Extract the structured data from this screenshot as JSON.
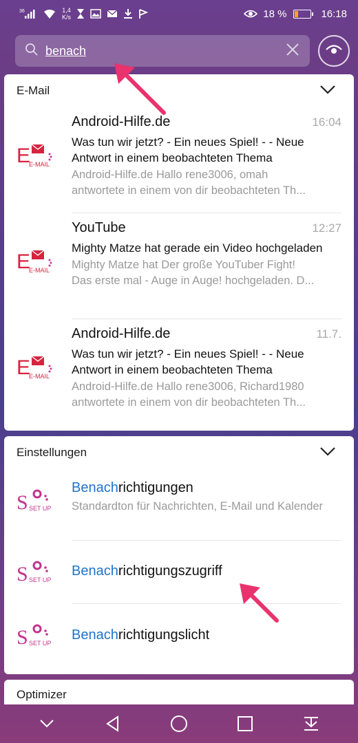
{
  "status_bar": {
    "signal": "36",
    "net_speed_value": "1,4",
    "net_speed_unit": "K/s",
    "battery_percent": "18 %",
    "battery_level": 0.18,
    "time": "16:18"
  },
  "search": {
    "query": "benach"
  },
  "email_section": {
    "title": "E-Mail",
    "icon_label": "E-MAIL",
    "items": [
      {
        "sender": "Android-Hilfe.de",
        "time": "16:04",
        "subject": "Was tun wir jetzt? - Ein neues Spiel! - - Neue Antwort in einem beobachteten Thema",
        "preview1": "Android-Hilfe.de Hallo rene3006, omah",
        "preview2": "antwortete in einem von dir beobachteten Th..."
      },
      {
        "sender": "YouTube",
        "time": "12:27",
        "subject": "Mighty Matze hat gerade ein Video hochgeladen",
        "preview1": "Mighty Matze hat Der große YouTuber Fight!",
        "preview2": "Das erste mal - Auge in Auge! hochgeladen. D..."
      },
      {
        "sender": "Android-Hilfe.de",
        "time": "11.7.",
        "subject": "Was tun wir jetzt? - Ein neues Spiel! - - Neue Antwort in einem beobachteten Thema",
        "preview1": "Android-Hilfe.de Hallo rene3006, Richard1980",
        "preview2": "antwortete in einem von dir beobachteten Th..."
      }
    ]
  },
  "settings_section": {
    "title": "Einstellungen",
    "icon_label": "SET UP",
    "items": [
      {
        "highlight": "Benach",
        "rest": "richtigungen",
        "subtitle": "Standardton für Nachrichten, E-Mail und Kalender"
      },
      {
        "highlight": "Benach",
        "rest": "richtigungszugriff",
        "subtitle": ""
      },
      {
        "highlight": "Benach",
        "rest": "richtigungslicht",
        "subtitle": ""
      }
    ]
  },
  "optimizer_section": {
    "title": "Optimizer"
  },
  "colors": {
    "highlight": "#1f73c9",
    "arrow": "#e8336e",
    "icon_red": "#d6243f",
    "icon_pink": "#c4338e"
  }
}
